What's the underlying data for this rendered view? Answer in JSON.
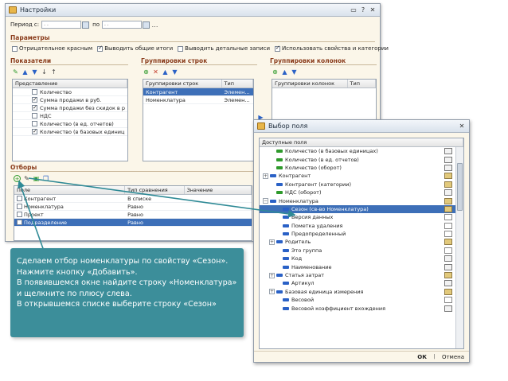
{
  "main_window": {
    "title": "Настройки",
    "period_from_label": "Период с:",
    "period_from_value": " .  .",
    "period_to_label": "по",
    "period_to_value": " .  .",
    "params_title": "Параметры",
    "params": [
      {
        "label": "Отрицательное красным",
        "checked": false
      },
      {
        "label": "Выводить общие итоги",
        "checked": true
      },
      {
        "label": "Выводить детальные записи",
        "checked": false
      },
      {
        "label": "Использовать свойства и категории",
        "checked": true
      }
    ],
    "indicators_title": "Показатели",
    "indicators_header": "Представление",
    "indicators": [
      {
        "label": "Количество",
        "checked": false
      },
      {
        "label": "Сумма продажи в руб.",
        "checked": true
      },
      {
        "label": "Сумма продажи без скидок в р",
        "checked": true
      },
      {
        "label": "НДС",
        "checked": false
      },
      {
        "label": "Количество (в ед. отчетов)",
        "checked": false
      },
      {
        "label": "Количество (в базовых единиц",
        "checked": true
      }
    ],
    "row_groups_title": "Группировки строк",
    "row_groups_headers": [
      "Группировки строк",
      "Тип"
    ],
    "row_groups": [
      {
        "name": "Контрагент",
        "type": "Элемен..."
      },
      {
        "name": "Номенклатура",
        "type": "Элемен..."
      }
    ],
    "col_groups_title": "Группировки колонок",
    "col_groups_headers": [
      "Группировки колонок",
      "Тип"
    ],
    "filters_title": "Отборы",
    "filters_headers": [
      "Поле",
      "Тип сравнения",
      "Значение"
    ],
    "filters": [
      {
        "field": "Контрагент",
        "comparison": "В списке",
        "value": ""
      },
      {
        "field": "Номенклатура",
        "comparison": "Равно",
        "value": ""
      },
      {
        "field": "Проект",
        "comparison": "Равно",
        "value": ""
      },
      {
        "field": "Подразделение",
        "comparison": "Равно",
        "value": ""
      }
    ]
  },
  "field_window": {
    "title": "Выбор поля",
    "header": "Доступные поля",
    "items": [
      {
        "label": "Количество (в базовых единицах)",
        "level": 1,
        "expand": "",
        "marker": "green",
        "type": "num"
      },
      {
        "label": "Количество (в ед. отчетов)",
        "level": 1,
        "expand": "",
        "marker": "green",
        "type": "num"
      },
      {
        "label": "Количество (оборот)",
        "level": 1,
        "expand": "",
        "marker": "green",
        "type": "num"
      },
      {
        "label": "Контрагент",
        "level": 0,
        "expand": "+",
        "marker": "blue",
        "type": "ref"
      },
      {
        "label": "Контрагент (категории)",
        "level": 1,
        "expand": "",
        "marker": "blue",
        "type": "ref"
      },
      {
        "label": "НДС (оборот)",
        "level": 1,
        "expand": "",
        "marker": "green",
        "type": "num"
      },
      {
        "label": "Номенклатура",
        "level": 0,
        "expand": "−",
        "marker": "blue",
        "type": "ref"
      },
      {
        "label": "Сезон (св-во Номенклатура)",
        "level": 2,
        "expand": "",
        "marker": "blue",
        "type": "ref",
        "selected": true
      },
      {
        "label": "Версия данных",
        "level": 2,
        "expand": "",
        "marker": "blue",
        "type": "chk"
      },
      {
        "label": "Пометка удаления",
        "level": 2,
        "expand": "",
        "marker": "blue",
        "type": "chk"
      },
      {
        "label": "Предопределенный",
        "level": 2,
        "expand": "",
        "marker": "blue",
        "type": "chk"
      },
      {
        "label": "Родитель",
        "level": 1,
        "expand": "+",
        "marker": "blue",
        "type": "ref"
      },
      {
        "label": "Это группа",
        "level": 2,
        "expand": "",
        "marker": "blue",
        "type": "chk"
      },
      {
        "label": "Код",
        "level": 2,
        "expand": "",
        "marker": "blue",
        "type": "num"
      },
      {
        "label": "Наименование",
        "level": 2,
        "expand": "",
        "marker": "blue",
        "type": "num"
      },
      {
        "label": "Статья затрат",
        "level": 1,
        "expand": "+",
        "marker": "blue",
        "type": "ref"
      },
      {
        "label": "Артикул",
        "level": 2,
        "expand": "",
        "marker": "blue",
        "type": "num"
      },
      {
        "label": "Базовая единица измерения",
        "level": 1,
        "expand": "+",
        "marker": "blue",
        "type": "ref"
      },
      {
        "label": "Весовой",
        "level": 2,
        "expand": "",
        "marker": "blue",
        "type": "chk"
      },
      {
        "label": "Весовой коэффициент вхождения",
        "level": 2,
        "expand": "",
        "marker": "blue",
        "type": "num"
      }
    ],
    "ok_label": "ОК",
    "cancel_label": "Отмена"
  },
  "callout": {
    "lines": [
      "Сделаем отбор номенклатуры по свойству «Сезон».",
      "Нажмите кнопку «Добавить».",
      "В появившемся окне найдите строку «Номенклатура»",
      "и щелкните по плюсу слева.",
      "В открывшемся списке выберите строку «Сезон»"
    ]
  },
  "colors": {
    "callout_bg": "#3c8e9a",
    "arrow": "#2f8a96",
    "section_title": "#8a3c1b",
    "selection": "#3d6fb8"
  }
}
